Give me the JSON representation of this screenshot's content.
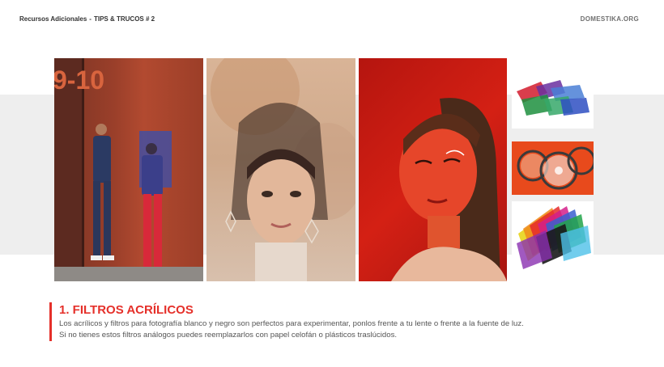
{
  "header": {
    "section": "Recursos Adicionales",
    "separator": "-",
    "topic": "TIPS & TRUCOS # 2",
    "brand": "DOMESTIKA.ORG"
  },
  "photos": [
    {
      "name": "couple-colored-wall",
      "wall_text": "9-10"
    },
    {
      "name": "multiple-exposure-portrait"
    },
    {
      "name": "red-light-portrait"
    }
  ],
  "filters": [
    "acrylic-filter-sheets",
    "round-lens-filters",
    "cellophane-color-sheets"
  ],
  "section": {
    "title": "1. FILTROS ACRÍLICOS",
    "lines": [
      "Los acrílicos y filtros para fotografía blanco y negro son perfectos para experimentar, ponlos frente a tu lente o frente a la fuente de luz.",
      "Si no tienes estos filtros análogos puedes reemplazarlos con papel celofán o plásticos traslúcidos."
    ]
  },
  "colors": {
    "accent": "#e5302a",
    "band": "#eeeeee"
  }
}
